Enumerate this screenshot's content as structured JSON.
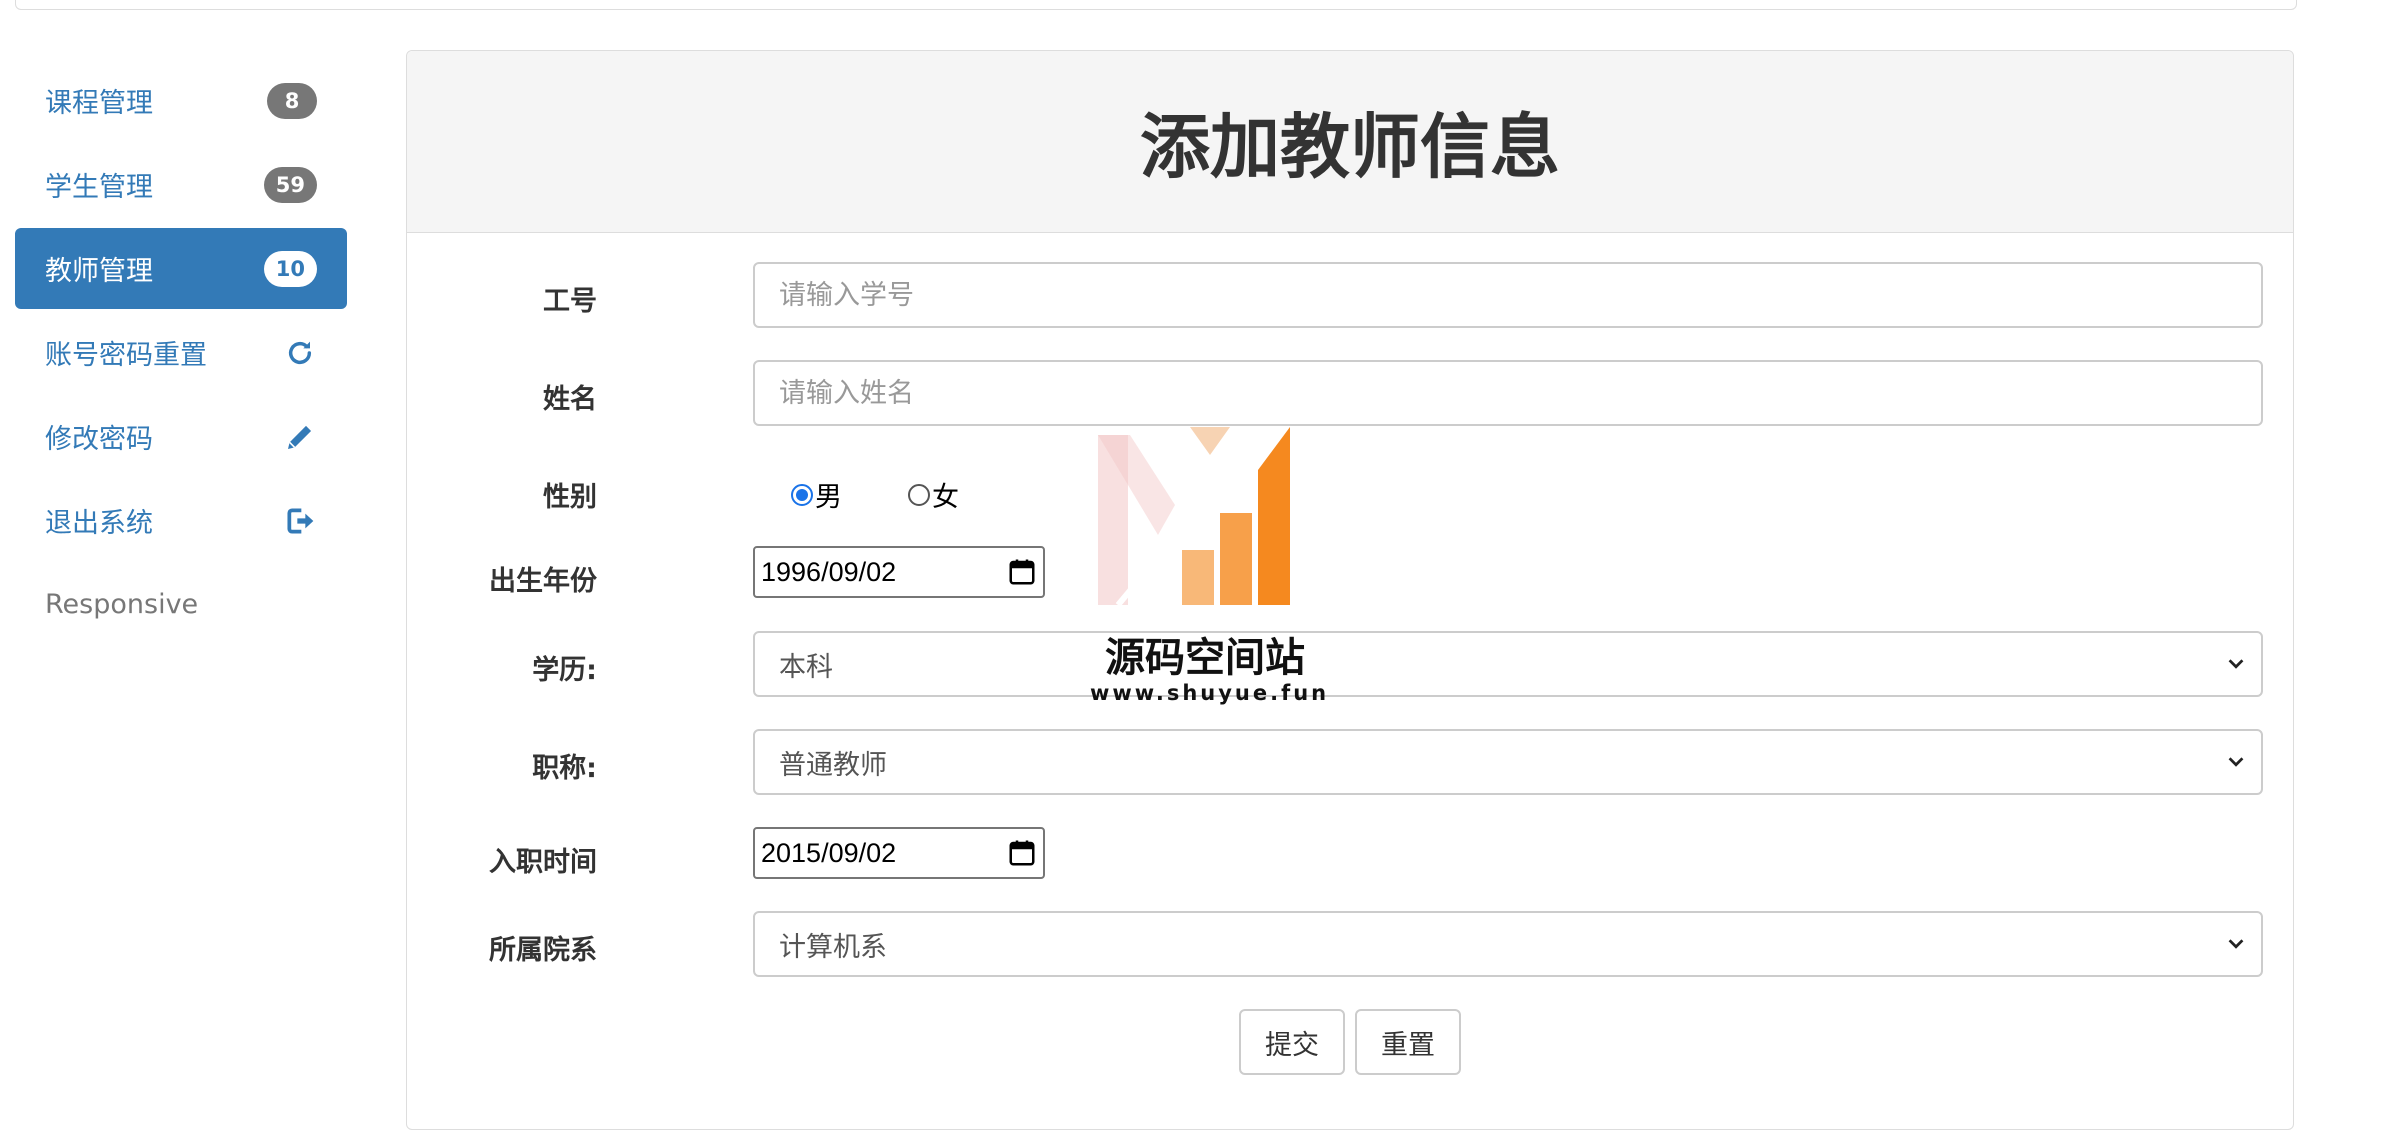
{
  "sidebar": {
    "items": [
      {
        "label": "课程管理",
        "badge": "8"
      },
      {
        "label": "学生管理",
        "badge": "59"
      },
      {
        "label": "教师管理",
        "badge": "10",
        "active": true
      },
      {
        "label": "账号密码重置",
        "icon": "refresh-icon"
      },
      {
        "label": "修改密码",
        "icon": "pencil-icon"
      },
      {
        "label": "退出系统",
        "icon": "logout-icon"
      },
      {
        "label": "Responsive"
      }
    ]
  },
  "panel": {
    "title": "添加教师信息"
  },
  "form": {
    "id_label": "工号",
    "id_placeholder": "请输入学号",
    "name_label": "姓名",
    "name_placeholder": "请输入姓名",
    "gender_label": "性别",
    "gender_options": [
      "男",
      "女"
    ],
    "gender_selected": "男",
    "birth_label": "出生年份",
    "birth_value": "1996/09/02",
    "education_label": "学历:",
    "education_value": "本科",
    "title_label": "职称:",
    "title_value": "普通教师",
    "hire_label": "入职时间",
    "hire_value": "2015/09/02",
    "dept_label": "所属院系",
    "dept_value": "计算机系",
    "submit_label": "提交",
    "reset_label": "重置"
  },
  "watermark": {
    "title": "源码空间站",
    "url": "www.shuyue.fun"
  },
  "colors": {
    "primary": "#337ab7",
    "badge": "#777777",
    "watermark_orange": "#f5891f"
  }
}
